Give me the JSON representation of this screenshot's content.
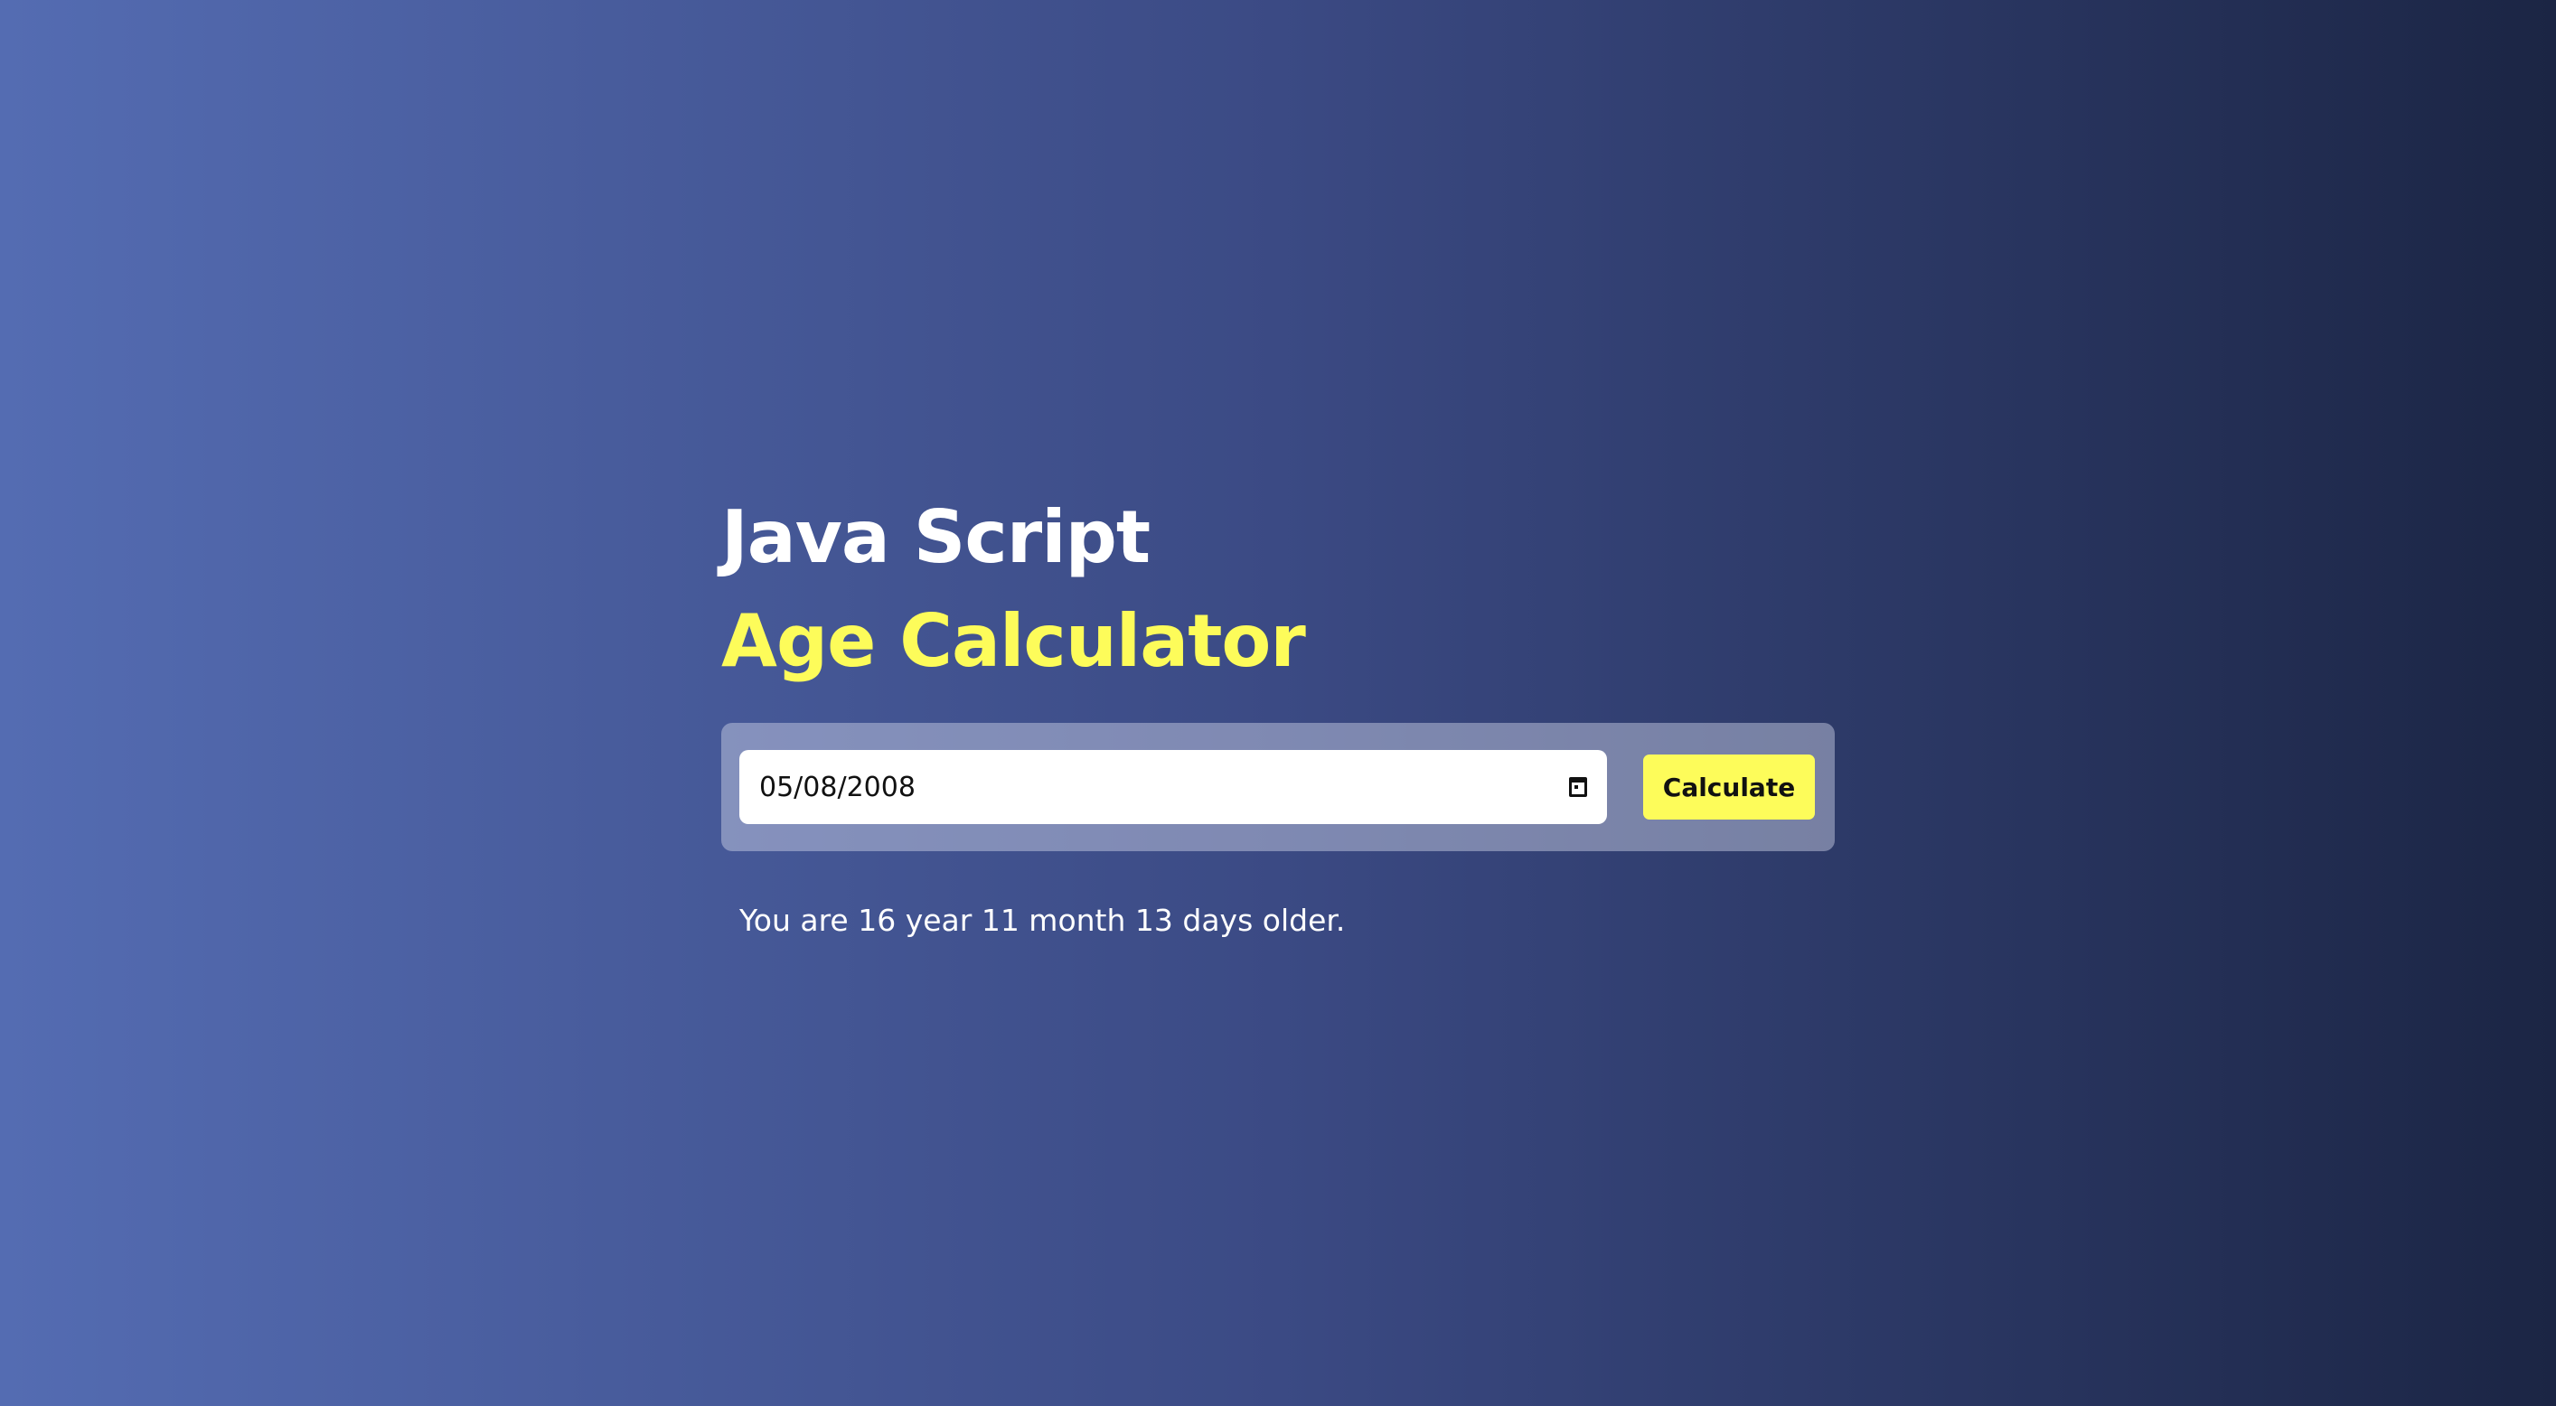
{
  "header": {
    "title_line1": "Java Script",
    "title_line2": "Age Calculator"
  },
  "form": {
    "date_value": "05/08/2008",
    "calculate_label": "Calculate"
  },
  "result": {
    "text": "You are 16 year 11 month 13 days older."
  },
  "colors": {
    "accent": "#fdfc5a",
    "gradient_start": "#546cb2",
    "gradient_end": "#1b2544"
  },
  "icons": {
    "date_picker": "calendar-icon"
  }
}
